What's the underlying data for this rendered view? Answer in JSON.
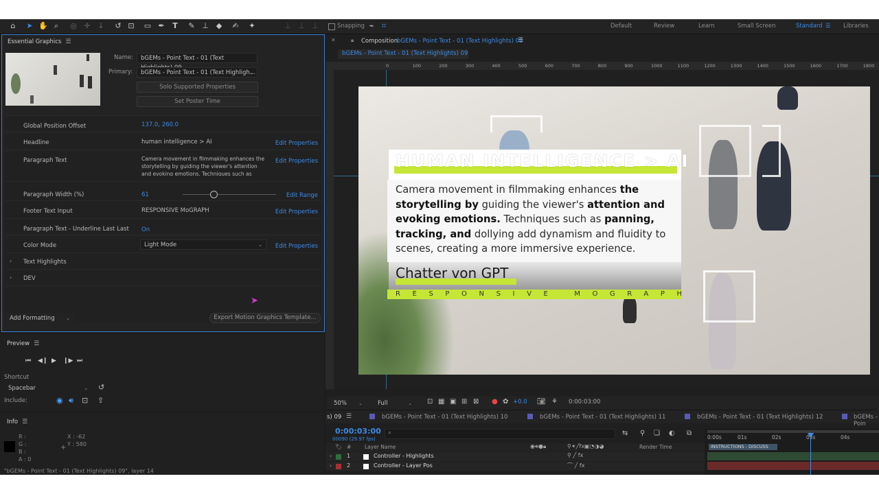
{
  "toolbar": {
    "snapping_label": "Snapping",
    "workspaces": [
      "Default",
      "Review",
      "Learn",
      "Small Screen",
      "Standard",
      "Libraries"
    ],
    "active_workspace": "Standard"
  },
  "essential_graphics": {
    "title": "Essential Graphics",
    "name_label": "Name:",
    "name_value": "bGEMs - Point Text - 01 (Text Highlights) 09",
    "primary_label": "Primary:",
    "primary_value": "bGEMs - Point Text - 01 (Text Highligh...",
    "solo_button": "Solo Supported Properties",
    "poster_button": "Set Poster Time",
    "properties": [
      {
        "label": "Global Position Offset",
        "value": "137.0, 260.0",
        "action": ""
      },
      {
        "label": "Headline",
        "value": "human intelligence > AI",
        "action": "Edit Properties"
      },
      {
        "label": "Paragraph Text",
        "value": "Camera movement in filmmaking enhances the storytelling by guiding the viewer's attention and evoking emotions. Techniques such as panning,",
        "action": "Edit Properties"
      },
      {
        "label": "Paragraph Width (%)",
        "value": "61",
        "action": "Edit Range"
      },
      {
        "label": "Footer Text Input",
        "value": "RESPONSIVE MoGRAPH",
        "action": "Edit Properties"
      },
      {
        "label": "Paragraph Text - Underline Last Last",
        "value": "On",
        "action": ""
      },
      {
        "label": "Color Mode",
        "value": "Light Mode",
        "action": "Edit Properties"
      }
    ],
    "groups": [
      "Text Highlights",
      "DEV"
    ],
    "add_formatting": "Add Formatting",
    "export_button": "Export Motion Graphics Template..."
  },
  "preview": {
    "title": "Preview",
    "shortcut_label": "Shortcut",
    "shortcut_value": "Spacebar",
    "include_label": "Include:"
  },
  "info": {
    "title": "Info",
    "r": "R :",
    "g": "G :",
    "b": "B :",
    "a": "A : 0",
    "x": "X : -62",
    "y": "Y : 580",
    "status": "\"bGEMs - Point Text - 01 (Text Highlights) 09\", layer 14"
  },
  "composition": {
    "panel_prefix": "Composition",
    "panel_name": "bGEMs - Point Text - 01 (Text Highlights) 09",
    "tab": "bGEMs - Point Text - 01 (Text Highlights) 09",
    "ruler_labels": [
      "0",
      "100",
      "200",
      "300",
      "400",
      "500",
      "600",
      "700",
      "800",
      "900",
      "1000",
      "1100",
      "1200",
      "1300",
      "1400",
      "1500",
      "1600",
      "1700",
      "1800",
      "1900"
    ],
    "headline": "HUMAN INTELLIGENCE > AI",
    "paragraph_parts": [
      {
        "t": "Camera movement in filmmaking enhances ",
        "b": false
      },
      {
        "t": "the storytelling by",
        "b": true
      },
      {
        "t": " guiding the viewer's ",
        "b": false
      },
      {
        "t": "attention and evoking emotions.",
        "b": true
      },
      {
        "t": " Techniques such as ",
        "b": false
      },
      {
        "t": "panning, tracking, and",
        "b": true
      },
      {
        "t": " dollying add dynamism and fluidity to scenes, creating a more immersive experience.",
        "b": false
      }
    ],
    "signature": "Chatter von GPT",
    "footer": "RESPONSIVE MOGRAPH",
    "zoom": "50%",
    "resolution": "Full",
    "exposure": "+0.0",
    "timecode": "0:00:03:00"
  },
  "timeline": {
    "tabs": [
      "s) 09",
      "bGEMs - Point Text - 01 (Text Highlights) 10",
      "bGEMs - Point Text - 01 (Text Highlights) 11",
      "bGEMs - Point Text - 01 (Text Highlights) 12",
      "bGEMs - Poin"
    ],
    "timecode": "0:00:03:00",
    "frames": "00090 (29.97 fps)",
    "col_hash": "#",
    "col_layer": "Layer Name",
    "col_render": "Render Time",
    "ticks": [
      "0:00s",
      "01s",
      "02s",
      "03s",
      "04s"
    ],
    "marker": "INSTRUCTIONS - DISCUSS",
    "layers": [
      {
        "num": "1",
        "name": "Controller - Highlights",
        "color": "#2f6f3a"
      },
      {
        "num": "2",
        "name": "Controller - Layer Pos",
        "color": "#a53232"
      }
    ]
  }
}
